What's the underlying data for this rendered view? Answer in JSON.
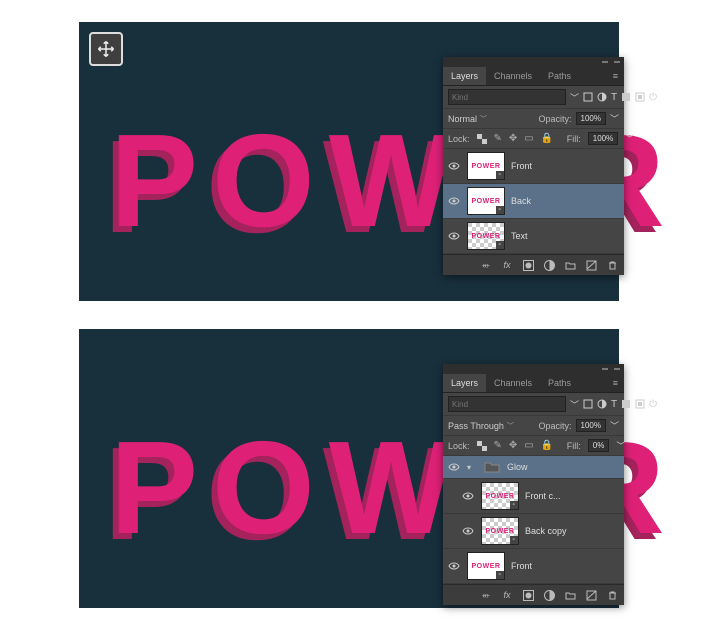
{
  "bigword": "POWER",
  "tool": {
    "name": "move"
  },
  "panels": {
    "top": {
      "tabs": [
        "Layers",
        "Channels",
        "Paths"
      ],
      "activeTab": 0,
      "filter": {
        "placeholder": "Kind"
      },
      "blendMode": "Normal",
      "opacityLabel": "Opacity:",
      "opacityValue": "100%",
      "lockLabel": "Lock:",
      "fillLabel": "Fill:",
      "fillValue": "100%",
      "layers": [
        {
          "name": "Front",
          "thumb": "POWER",
          "checker": false,
          "selected": false
        },
        {
          "name": "Back",
          "thumb": "POWER",
          "checker": false,
          "selected": true
        },
        {
          "name": "Text",
          "thumb": "POWER",
          "checker": true,
          "selected": false
        }
      ],
      "footer": [
        "link",
        "fx",
        "mask",
        "adjust",
        "group",
        "new",
        "trash"
      ]
    },
    "bottom": {
      "tabs": [
        "Layers",
        "Channels",
        "Paths"
      ],
      "activeTab": 0,
      "filter": {
        "placeholder": "Kind"
      },
      "blendMode": "Pass Through",
      "opacityLabel": "Opacity:",
      "opacityValue": "100%",
      "lockLabel": "Lock:",
      "fillLabel": "Fill:",
      "fillValue": "0%",
      "folderName": "Glow",
      "layers": [
        {
          "name": "Front c...",
          "thumb": "POWER",
          "checker": true,
          "selected": false
        },
        {
          "name": "Back copy",
          "thumb": "POWER",
          "checker": true,
          "selected": false
        },
        {
          "name": "Front",
          "thumb": "POWER",
          "checker": false,
          "selected": false
        }
      ],
      "footer": [
        "link",
        "fx",
        "mask",
        "adjust",
        "group",
        "new",
        "trash"
      ]
    }
  }
}
